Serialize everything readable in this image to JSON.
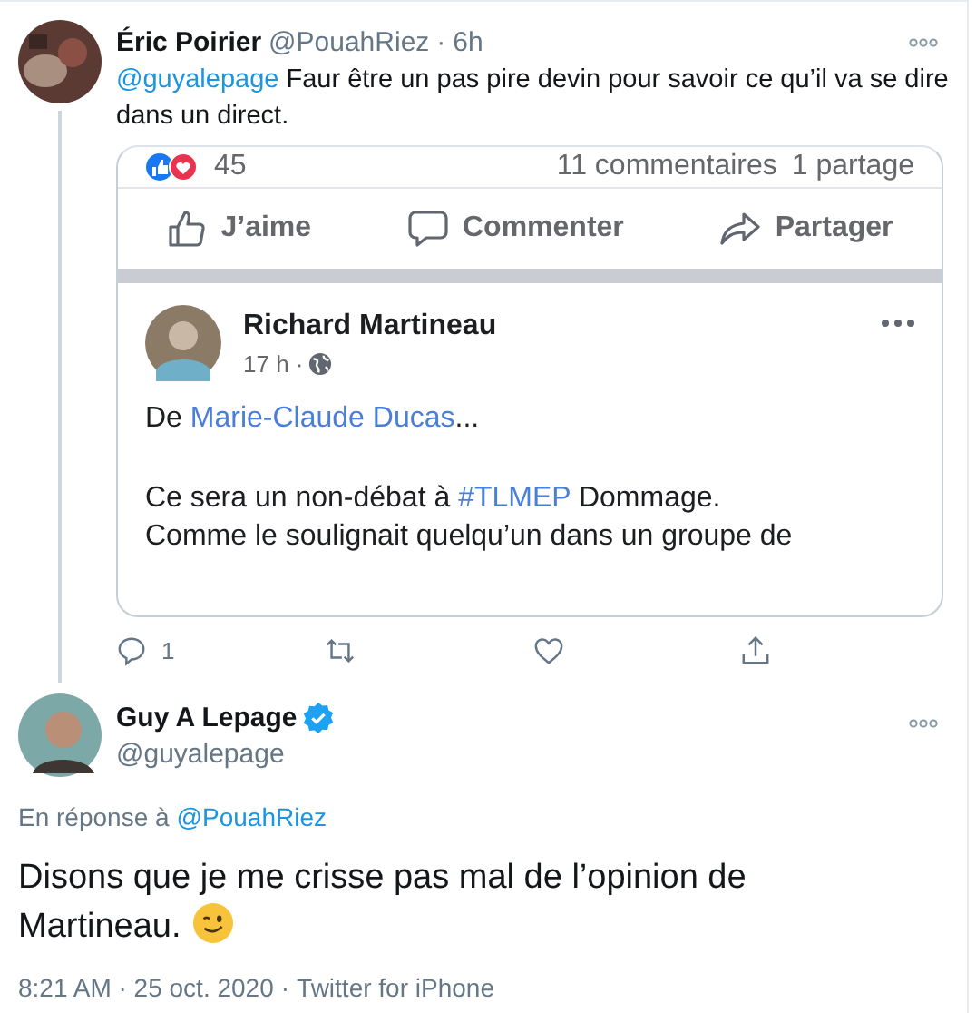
{
  "reply_tweet": {
    "author": "Éric Poirier",
    "handle": "@PouahRiez",
    "separator": "·",
    "time": "6h",
    "mention": "@guyalepage",
    "text": "Faur être un pas pire devin pour savoir ce qu’il va se dire dans un direct.",
    "screenshot": {
      "reaction_count": "45",
      "comments": "11 commentaires",
      "shares": "1 partage",
      "actions": [
        {
          "kind": "like",
          "label": "J’aime"
        },
        {
          "kind": "comment",
          "label": "Commenter"
        },
        {
          "kind": "share",
          "label": "Partager"
        }
      ],
      "post": {
        "author": "Richard Martineau",
        "time": "17 h ·",
        "text": "De **Marie-Claude Ducas**...",
        "body": [
          "Ce sera un non-débat à #TLMEP Dommage.",
          "Comme le soulignait quelqu’un dans un groupe de"
        ]
      }
    },
    "reply_count": "1"
  },
  "main_tweet": {
    "author": "Guy A Lepage",
    "verified": true,
    "handle": "@guyalepage",
    "reply_label": "En réponse à",
    "reply_to": "@PouahRiez",
    "text": [
      "Disons que je me crisse pas mal de l’opinion de",
      "Martineau."
    ],
    "timestamp": "8:21 AM · 25 oct. 2020",
    "separator": "·",
    "source": "Twitter for iPhone"
  }
}
